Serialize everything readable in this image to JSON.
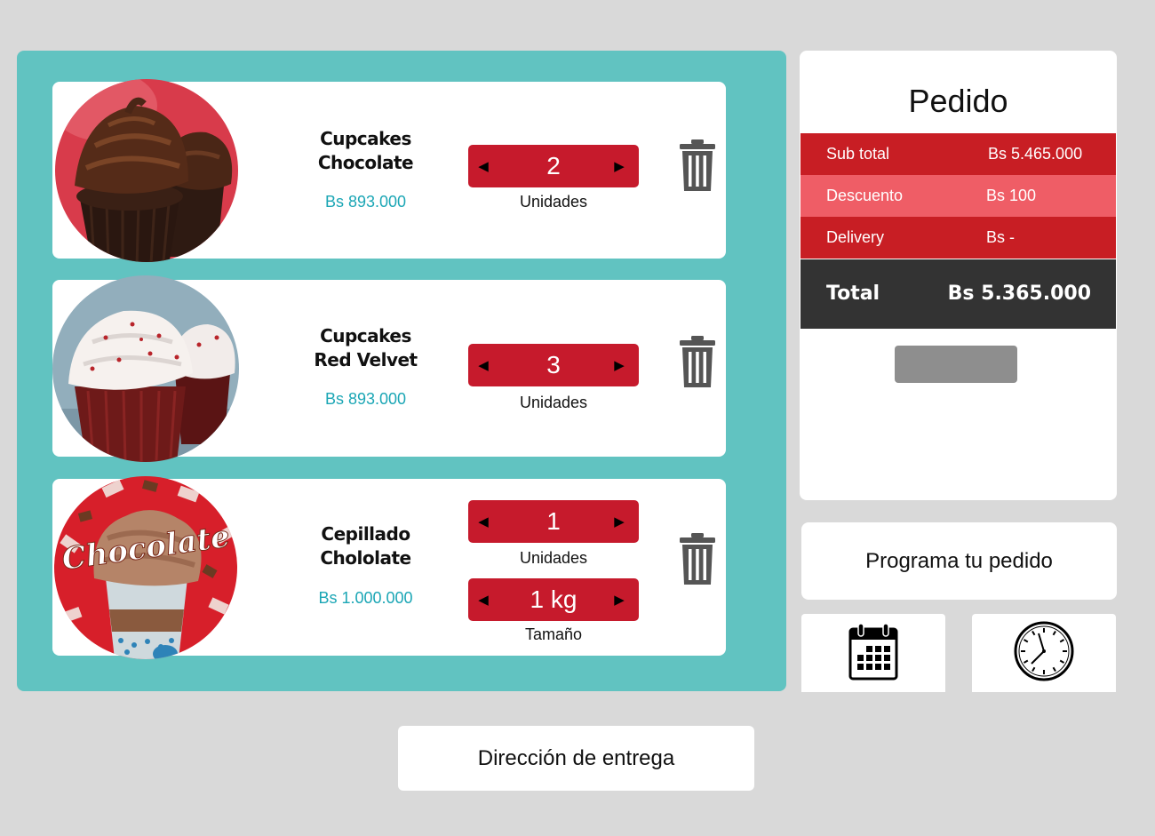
{
  "cart": {
    "items": [
      {
        "name_line1": "Cupcakes",
        "name_line2": "Chocolate",
        "price": "Bs 893.000",
        "quantity": "2",
        "quantity_label": "Unidades"
      },
      {
        "name_line1": "Cupcakes",
        "name_line2": "Red Velvet",
        "price": "Bs 893.000",
        "quantity": "3",
        "quantity_label": "Unidades"
      },
      {
        "name_line1": "Cepillado",
        "name_line2": "Chololate",
        "price": "Bs 1.000.000",
        "quantity": "1",
        "quantity_label": "Unidades",
        "size": "1 kg",
        "size_label": "Tamaño",
        "image_text": "Chocolate"
      }
    ]
  },
  "order": {
    "title": "Pedido",
    "rows": [
      {
        "label": "Sub total",
        "amount": "Bs 5.465.000",
        "color": "#c81e24"
      },
      {
        "label": "Descuento",
        "amount": "Bs 100",
        "color": "#ef5d66"
      },
      {
        "label": "Delivery",
        "amount": "Bs -",
        "color": "#c81e24"
      }
    ],
    "total_label": "Total",
    "total_amount": "Bs 5.365.000",
    "total_color": "#333333"
  },
  "schedule": {
    "label": "Programa tu pedido",
    "date_icon": "calendar-icon",
    "time_icon": "clock-icon"
  },
  "delivery": {
    "address_label": "Dirección de entrega"
  },
  "colors": {
    "page_bg": "#d9d9d9",
    "cart_bg": "#61c3c1",
    "accent_red": "#c61a2c",
    "price_teal": "#1ba6b5"
  }
}
